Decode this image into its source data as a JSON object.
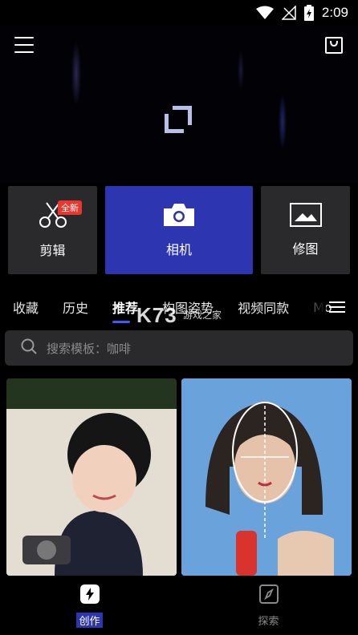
{
  "status_bar": {
    "time": "2:09"
  },
  "tools": {
    "edit": {
      "label": "剪辑",
      "badge": "全新",
      "icon": "scissors-icon"
    },
    "camera": {
      "label": "相机",
      "icon": "camera-icon"
    },
    "retouch": {
      "label": "修图",
      "icon": "picture-icon"
    }
  },
  "tabs": [
    {
      "label": "收藏"
    },
    {
      "label": "历史"
    },
    {
      "label": "推荐"
    },
    {
      "label": "构图姿势"
    },
    {
      "label": "视频同款"
    },
    {
      "label": "Mo"
    }
  ],
  "watermark": {
    "main": "K73",
    "sub": "游戏之家"
  },
  "search": {
    "placeholder": "搜索模板：咖啡"
  },
  "bottom_nav": {
    "create": {
      "label": "创作",
      "icon": "lightning-icon"
    },
    "explore": {
      "label": "探索",
      "icon": "compass-icon"
    }
  },
  "colors": {
    "accent": "#2e35b0",
    "tab_underline": "#3a5bff",
    "badge": "#e8372f"
  }
}
